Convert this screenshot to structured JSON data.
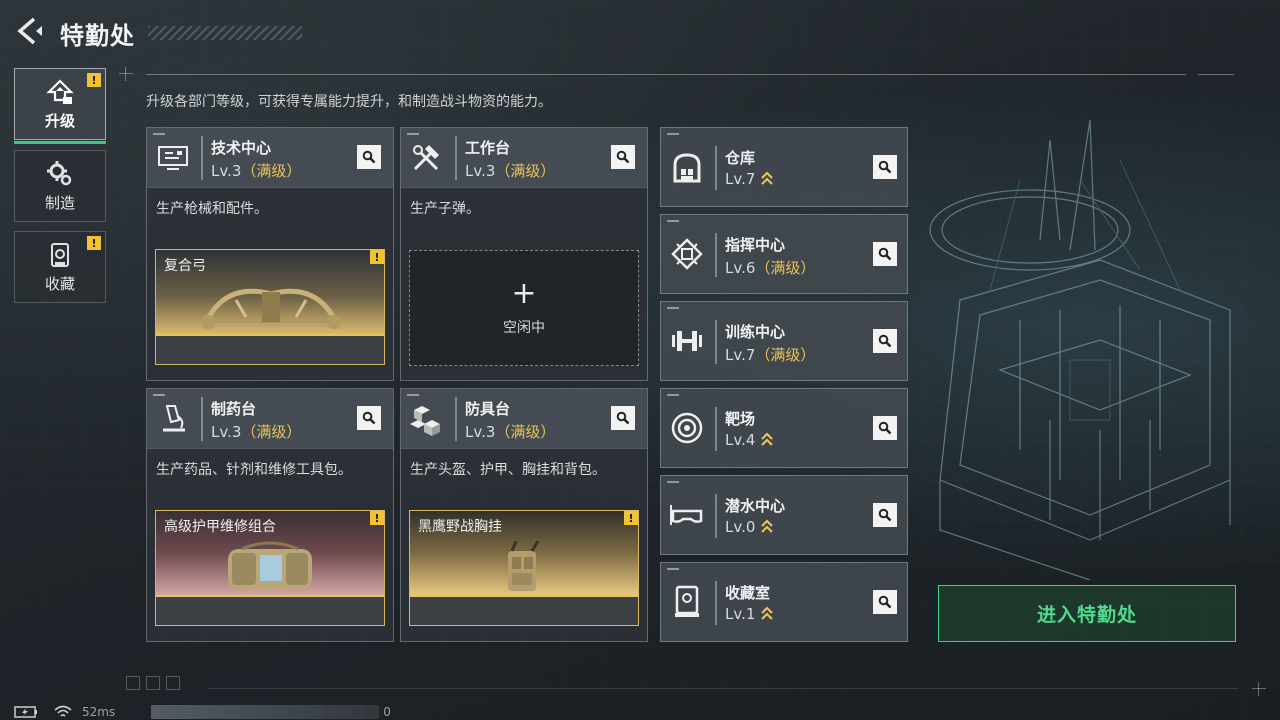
{
  "header": {
    "title": "特勤处",
    "subtitle": "升级各部门等级，可获得专属能力提升，和制造战斗物资的能力。"
  },
  "nav": [
    {
      "label": "升级",
      "icon": "upgrade-icon",
      "active": true,
      "warning": "!"
    },
    {
      "label": "制造",
      "icon": "gears-icon",
      "active": false
    },
    {
      "label": "收藏",
      "icon": "collection-icon",
      "active": false,
      "warning": "!"
    }
  ],
  "facilities": [
    {
      "name": "技术中心",
      "level": "Lv.3",
      "max": "（满级）",
      "icon": "computer-icon",
      "desc": "生产枪械和配件。",
      "item": "复合弓",
      "item_warning": "!"
    },
    {
      "name": "工作台",
      "level": "Lv.3",
      "max": "（满级）",
      "icon": "tools-icon",
      "desc": "生产子弹。",
      "idle_plus": "+",
      "idle": "空闲中"
    },
    {
      "name": "制药台",
      "level": "Lv.3",
      "max": "（满级）",
      "icon": "microscope-icon",
      "desc": "生产药品、针剂和维修工具包。",
      "item": "高级护甲维修组合",
      "item_warning": "!"
    },
    {
      "name": "防具台",
      "level": "Lv.3",
      "max": "（满级）",
      "icon": "boxes-icon",
      "desc": "生产头盔、护甲、胸挂和背包。",
      "item": "黑鹰野战胸挂",
      "item_warning": "!"
    }
  ],
  "side_facilities": [
    {
      "name": "仓库",
      "level": "Lv.7",
      "max": "",
      "icon": "warehouse-icon",
      "upgradable": true
    },
    {
      "name": "指挥中心",
      "level": "Lv.6",
      "max": "（满级）",
      "icon": "chip-icon",
      "upgradable": false
    },
    {
      "name": "训练中心",
      "level": "Lv.7",
      "max": "（满级）",
      "icon": "dumbbell-icon",
      "upgradable": false
    },
    {
      "name": "靶场",
      "level": "Lv.4",
      "max": "",
      "icon": "target-icon",
      "upgradable": true
    },
    {
      "name": "潜水中心",
      "level": "Lv.0",
      "max": "",
      "icon": "goggles-icon",
      "upgradable": true
    },
    {
      "name": "收藏室",
      "level": "Lv.1",
      "max": "",
      "icon": "showcase-icon",
      "upgradable": true
    }
  ],
  "enter_button": "进入特勤处",
  "status": {
    "ping": "52ms",
    "value": "0"
  },
  "colors": {
    "accent_green": "#3fd07f",
    "max_gold": "#e8c35a",
    "warning_yellow": "#f2c230"
  }
}
